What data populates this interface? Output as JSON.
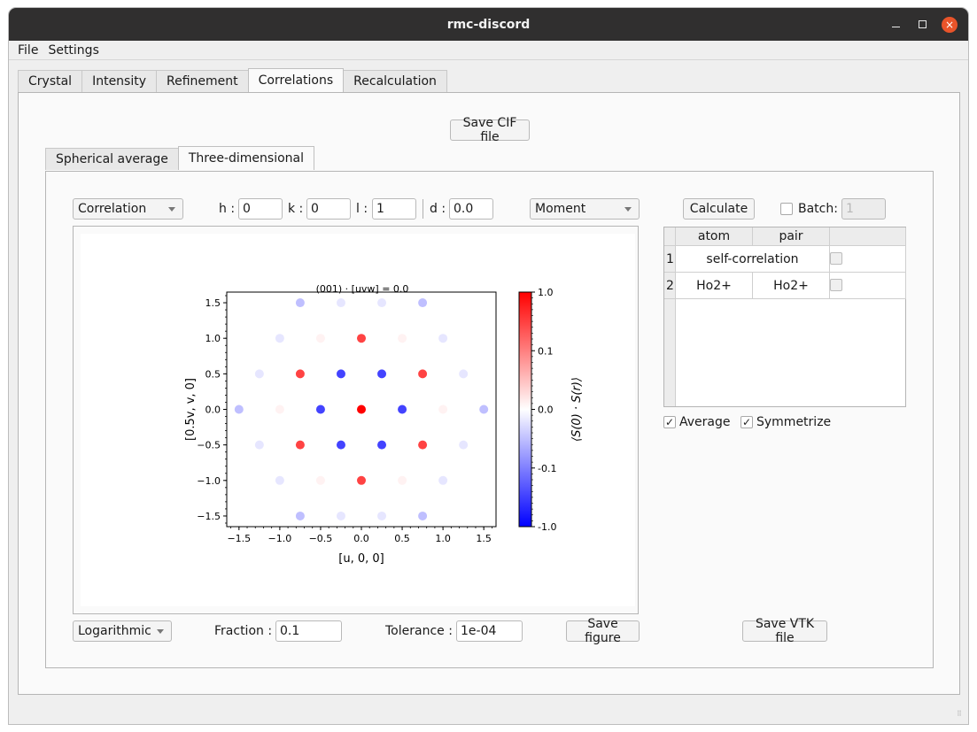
{
  "window": {
    "title": "rmc-discord",
    "controls": {
      "minimize": "minimize",
      "maximize": "maximize",
      "close": "×"
    }
  },
  "menu": {
    "items": [
      "File",
      "Settings"
    ]
  },
  "tabs": {
    "items": [
      "Crystal",
      "Intensity",
      "Refinement",
      "Correlations",
      "Recalculation"
    ],
    "active": "Correlations"
  },
  "correlations": {
    "save_cif_label": "Save CIF file",
    "subtabs": [
      "Spherical average",
      "Three-dimensional"
    ],
    "active_subtab": "Three-dimensional",
    "controls": {
      "type_combo": "Correlation",
      "h_label": "h :",
      "h_value": "0",
      "k_label": "k :",
      "k_value": "0",
      "l_label": "l :",
      "l_value": "1",
      "d_label": "d :",
      "d_value": "0.0",
      "quantity_combo": "Moment",
      "calculate_label": "Calculate",
      "batch_label": "Batch:",
      "batch_value": "1",
      "batch_checked": false
    },
    "table": {
      "headers": [
        "atom",
        "pair",
        ""
      ],
      "rows": [
        {
          "index": "1",
          "atom": "self-correlation",
          "pair": "",
          "span": true,
          "checked": false
        },
        {
          "index": "2",
          "atom": "Ho2+",
          "pair": "Ho2+",
          "span": false,
          "checked": false
        }
      ]
    },
    "average_label": "Average",
    "average_checked": true,
    "symmetrize_label": "Symmetrize",
    "symmetrize_checked": true,
    "bottom": {
      "scale_combo": "Logarithmic",
      "fraction_label": "Fraction :",
      "fraction_value": "0.1",
      "tolerance_label": "Tolerance :",
      "tolerance_value": "1e-04",
      "save_figure_label": "Save figure",
      "save_vtk_label": "Save VTK file"
    }
  },
  "chart_data": {
    "type": "scatter",
    "title": "(001) · [uvw] = 0.0",
    "xlabel": "[u, 0, 0]",
    "ylabel": "[0.5v, v, 0]",
    "xlim": [
      -1.65,
      1.65
    ],
    "ylim": [
      -1.65,
      1.65
    ],
    "xticks": [
      "-1.5",
      "-1.0",
      "-0.5",
      "0.0",
      "0.5",
      "1.0",
      "1.5"
    ],
    "yticks": [
      "-1.5",
      "-1.0",
      "-0.5",
      "0.0",
      "0.5",
      "1.0",
      "1.5"
    ],
    "colorbar": {
      "label": "⟨S(0) · S(r)⟩",
      "ticks": [
        "1.0",
        "0.1",
        "0.0",
        "-0.1",
        "-1.0"
      ],
      "scale": "symlog",
      "range": [
        -1.0,
        1.0
      ],
      "colormap": "bwr"
    },
    "points": [
      {
        "x": -0.75,
        "y": 1.5,
        "c": -0.05
      },
      {
        "x": -0.25,
        "y": 1.5,
        "c": -0.02
      },
      {
        "x": 0.25,
        "y": 1.5,
        "c": -0.02
      },
      {
        "x": 0.75,
        "y": 1.5,
        "c": -0.05
      },
      {
        "x": -1.0,
        "y": 1.0,
        "c": -0.02
      },
      {
        "x": -0.5,
        "y": 1.0,
        "c": 0.01
      },
      {
        "x": 0.0,
        "y": 1.0,
        "c": 0.3
      },
      {
        "x": 0.5,
        "y": 1.0,
        "c": 0.01
      },
      {
        "x": 1.0,
        "y": 1.0,
        "c": -0.02
      },
      {
        "x": -1.25,
        "y": 0.5,
        "c": -0.02
      },
      {
        "x": -0.75,
        "y": 0.5,
        "c": 0.3
      },
      {
        "x": -0.25,
        "y": 0.5,
        "c": -0.3
      },
      {
        "x": 0.25,
        "y": 0.5,
        "c": -0.3
      },
      {
        "x": 0.75,
        "y": 0.5,
        "c": 0.3
      },
      {
        "x": 1.25,
        "y": 0.5,
        "c": -0.02
      },
      {
        "x": -1.5,
        "y": 0.0,
        "c": -0.05
      },
      {
        "x": -1.0,
        "y": 0.0,
        "c": 0.01
      },
      {
        "x": -0.5,
        "y": 0.0,
        "c": -0.3
      },
      {
        "x": 0.0,
        "y": 0.0,
        "c": 1.0
      },
      {
        "x": 0.5,
        "y": 0.0,
        "c": -0.3
      },
      {
        "x": 1.0,
        "y": 0.0,
        "c": 0.01
      },
      {
        "x": 1.5,
        "y": 0.0,
        "c": -0.05
      },
      {
        "x": -1.25,
        "y": -0.5,
        "c": -0.02
      },
      {
        "x": -0.75,
        "y": -0.5,
        "c": 0.3
      },
      {
        "x": -0.25,
        "y": -0.5,
        "c": -0.3
      },
      {
        "x": 0.25,
        "y": -0.5,
        "c": -0.3
      },
      {
        "x": 0.75,
        "y": -0.5,
        "c": 0.3
      },
      {
        "x": 1.25,
        "y": -0.5,
        "c": -0.02
      },
      {
        "x": -1.0,
        "y": -1.0,
        "c": -0.02
      },
      {
        "x": -0.5,
        "y": -1.0,
        "c": 0.01
      },
      {
        "x": 0.0,
        "y": -1.0,
        "c": 0.3
      },
      {
        "x": 0.5,
        "y": -1.0,
        "c": 0.01
      },
      {
        "x": 1.0,
        "y": -1.0,
        "c": -0.02
      },
      {
        "x": -0.75,
        "y": -1.5,
        "c": -0.05
      },
      {
        "x": -0.25,
        "y": -1.5,
        "c": -0.02
      },
      {
        "x": 0.25,
        "y": -1.5,
        "c": -0.02
      },
      {
        "x": 0.75,
        "y": -1.5,
        "c": -0.05
      }
    ]
  }
}
